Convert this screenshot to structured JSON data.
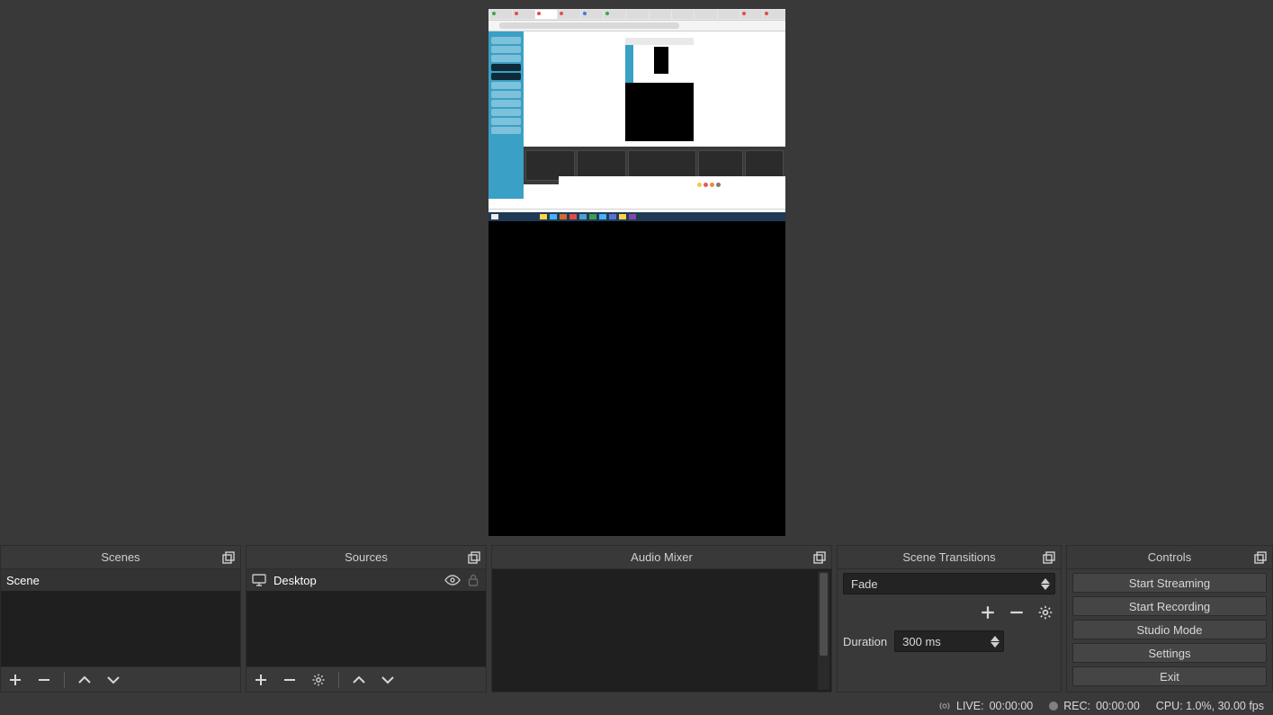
{
  "panels": {
    "scenes": {
      "title": "Scenes",
      "items": [
        "Scene"
      ]
    },
    "sources": {
      "title": "Sources",
      "items": [
        {
          "name": "Desktop"
        }
      ]
    },
    "mixer": {
      "title": "Audio Mixer"
    },
    "transitions": {
      "title": "Scene Transitions",
      "selected": "Fade",
      "duration_label": "Duration",
      "duration_value": "300 ms"
    },
    "controls": {
      "title": "Controls",
      "buttons": {
        "start_streaming": "Start Streaming",
        "start_recording": "Start Recording",
        "studio_mode": "Studio Mode",
        "settings": "Settings",
        "exit": "Exit"
      }
    }
  },
  "status": {
    "live_label": "LIVE:",
    "live_time": "00:00:00",
    "rec_label": "REC:",
    "rec_time": "00:00:00",
    "cpu": "CPU: 1.0%, 30.00 fps"
  }
}
